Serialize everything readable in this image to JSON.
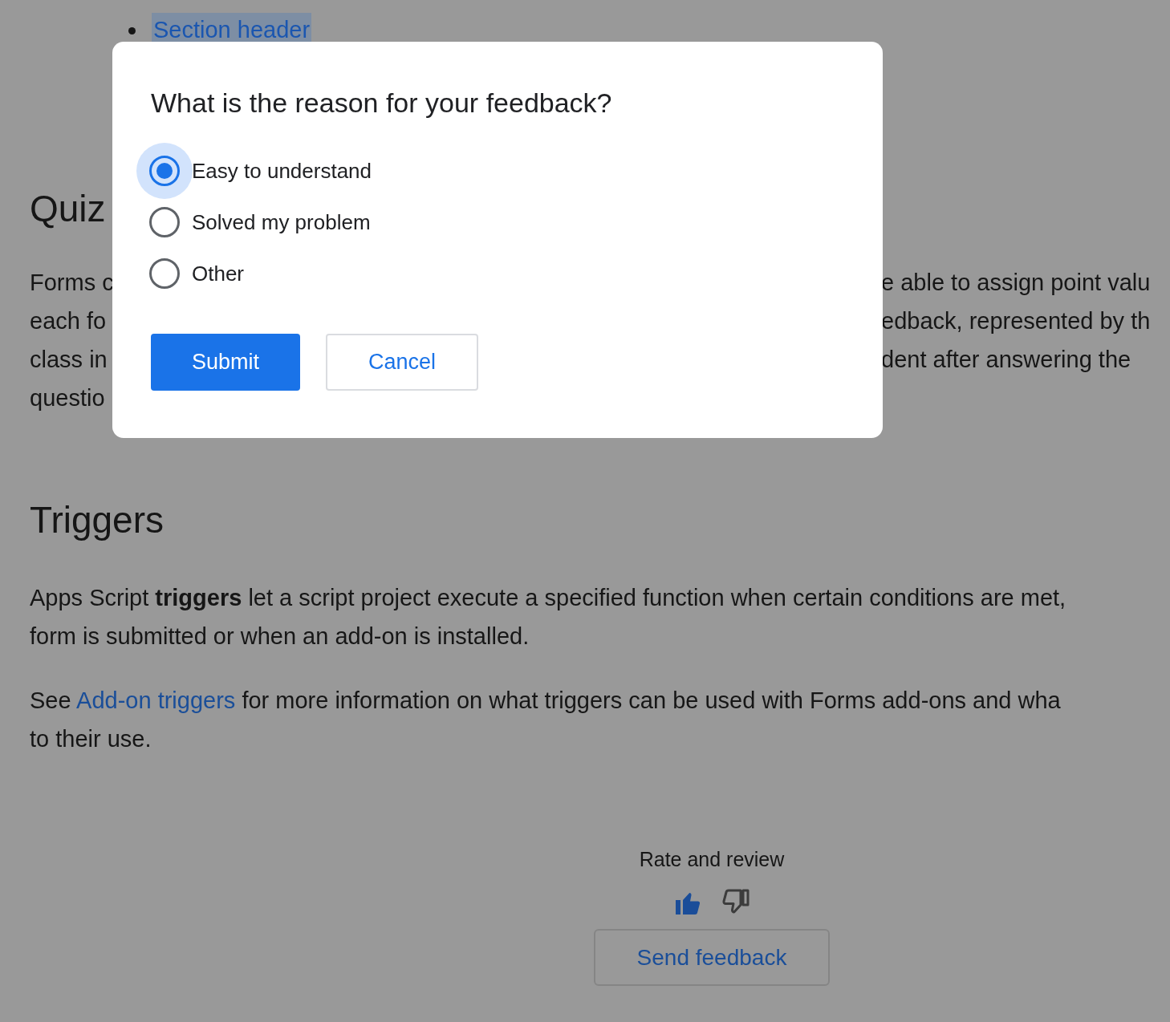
{
  "page": {
    "bullets": [
      {
        "text": "Section header",
        "highlighted": true
      }
    ],
    "quiz": {
      "heading": "Quiz",
      "left_fragments": [
        "Forms c",
        "each fo",
        "class in",
        "questio"
      ],
      "right_fragments": [
        "e able to assign point valu",
        "edback, represented by th",
        "dent after answering the"
      ]
    },
    "triggers": {
      "heading": "Triggers",
      "paragraph_lines": [
        "Apps Script **triggers** let a script project execute a specified function when certain conditions are met,",
        "form is submitted or when an add-on is installed."
      ],
      "see": {
        "before": "See ",
        "link": "Add-on triggers",
        "after_lines": [
          " for more information on what triggers can be used with Forms add-ons and wha",
          "to their use."
        ]
      }
    },
    "rating": {
      "label": "Rate and review",
      "thumbs": [
        {
          "kind": "up",
          "selected": true
        },
        {
          "kind": "down",
          "selected": false
        }
      ],
      "button": "Send feedback"
    }
  },
  "dialog": {
    "title": "What is the reason for your feedback?",
    "options": [
      {
        "label": "Easy to understand",
        "selected": true
      },
      {
        "label": "Solved my problem",
        "selected": false
      },
      {
        "label": "Other",
        "selected": false
      }
    ],
    "buttons": [
      {
        "kind": "primary",
        "label": "Submit"
      },
      {
        "kind": "secondary",
        "label": "Cancel"
      }
    ]
  }
}
